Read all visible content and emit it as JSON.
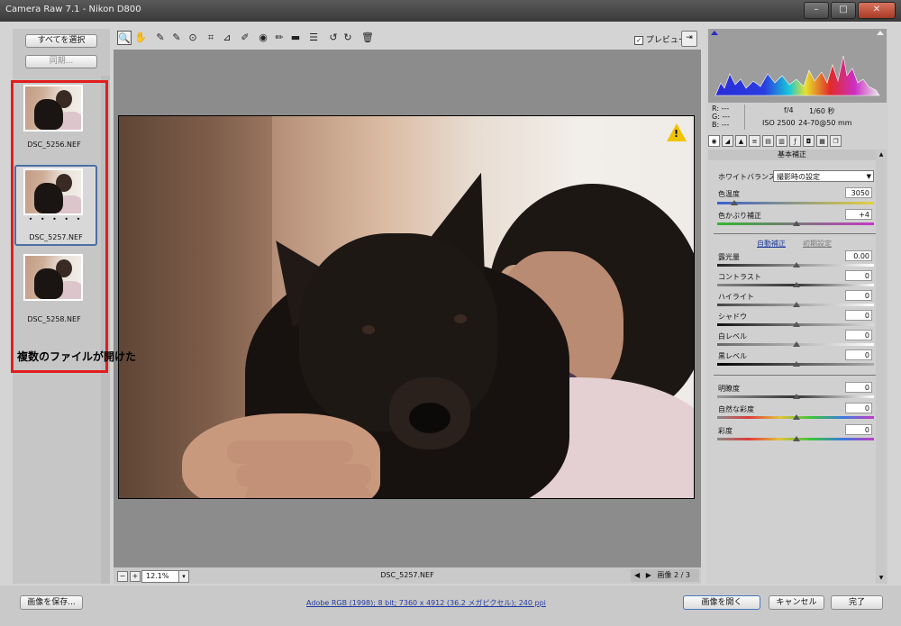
{
  "window": {
    "title": "Camera Raw 7.1  -  Nikon D800",
    "minimize": "–",
    "maximize": "□",
    "close": "✕"
  },
  "filmstrip": {
    "select_all": "すべてを選択",
    "sync": "同期...",
    "thumbs": [
      {
        "name": "DSC_5256.NEF",
        "selected": false
      },
      {
        "name": "DSC_5257.NEF",
        "selected": true,
        "rating": "• • • • •"
      },
      {
        "name": "DSC_5258.NEF",
        "selected": false
      }
    ],
    "annotation": "複数のファイルが開けた"
  },
  "toolbar": {
    "tools": [
      "zoom-icon",
      "hand-icon",
      "white-balance-icon",
      "color-sampler-icon",
      "target-adjust-icon",
      "crop-icon",
      "straighten-icon",
      "spot-removal-icon",
      "red-eye-icon",
      "adjustment-brush-icon",
      "graduated-filter-icon",
      "preferences-icon",
      "rotate-ccw-icon",
      "rotate-cw-icon",
      "trash-icon"
    ],
    "preview_label": "プレビュー",
    "preview_checked": "✓"
  },
  "canvas": {
    "zoom_minus": "−",
    "zoom_plus": "+",
    "zoom": "12.1%",
    "zoom_dropdown": "▾",
    "current_file": "DSC_5257.NEF",
    "nav_prev": "◀",
    "nav_next": "▶",
    "image_count": "画像 2 / 3",
    "warning": "!"
  },
  "info": {
    "r": "R:   ---",
    "g": "G:   ---",
    "b": "B:   ---",
    "aperture": "f/4",
    "shutter": "1/60 秒",
    "iso": "ISO 2500",
    "lens": "24-70@50 mm"
  },
  "panel": {
    "title": "基本補正",
    "wb_label": "ホワイトバランス：",
    "wb_value": "撮影時の設定",
    "temp_label": "色温度",
    "temp_value": "3050",
    "tint_label": "色かぶり補正",
    "tint_value": "+4",
    "auto": "自動補正",
    "default": "初期設定",
    "sliders": [
      {
        "label": "露光量",
        "value": "0.00"
      },
      {
        "label": "コントラスト",
        "value": "0"
      },
      {
        "label": "ハイライト",
        "value": "0"
      },
      {
        "label": "シャドウ",
        "value": "0"
      },
      {
        "label": "白レベル",
        "value": "0"
      },
      {
        "label": "黒レベル",
        "value": "0"
      }
    ],
    "presence": [
      {
        "label": "明瞭度",
        "value": "0"
      },
      {
        "label": "自然な彩度",
        "value": "0"
      },
      {
        "label": "彩度",
        "value": "0"
      }
    ]
  },
  "bottom": {
    "save": "画像を保存...",
    "workflow": "Adobe RGB (1998); 8 bit; 7360 x 4912 (36.2 メガピクセル); 240 ppi",
    "open": "画像を開く",
    "cancel": "キャンセル",
    "done": "完了"
  }
}
